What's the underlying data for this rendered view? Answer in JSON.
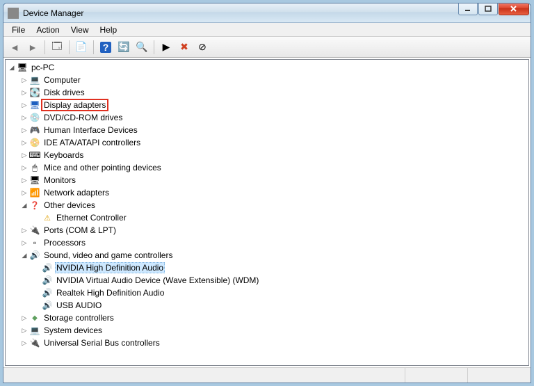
{
  "window": {
    "title": "Device Manager"
  },
  "menu": {
    "file": "File",
    "action": "Action",
    "view": "View",
    "help": "Help"
  },
  "tree": {
    "root": "pc-PC",
    "computer": "Computer",
    "disk_drives": "Disk drives",
    "display_adapters": "Display adapters",
    "dvd": "DVD/CD-ROM drives",
    "hid": "Human Interface Devices",
    "ide": "IDE ATA/ATAPI controllers",
    "keyboards": "Keyboards",
    "mice": "Mice and other pointing devices",
    "monitors": "Monitors",
    "network": "Network adapters",
    "other": "Other devices",
    "ethernet": "Ethernet Controller",
    "ports": "Ports (COM & LPT)",
    "processors": "Processors",
    "sound": "Sound, video and game controllers",
    "sound_items": {
      "nvidia_hd": "NVIDIA High Definition Audio",
      "nvidia_wdm": "NVIDIA Virtual Audio Device (Wave Extensible) (WDM)",
      "realtek": "Realtek High Definition Audio",
      "usb_audio": "USB  AUDIO"
    },
    "storage": "Storage controllers",
    "system": "System devices",
    "usb": "Universal Serial Bus controllers"
  },
  "highlighted_node": "display_adapters",
  "selected_node": "sound_items.nvidia_hd"
}
